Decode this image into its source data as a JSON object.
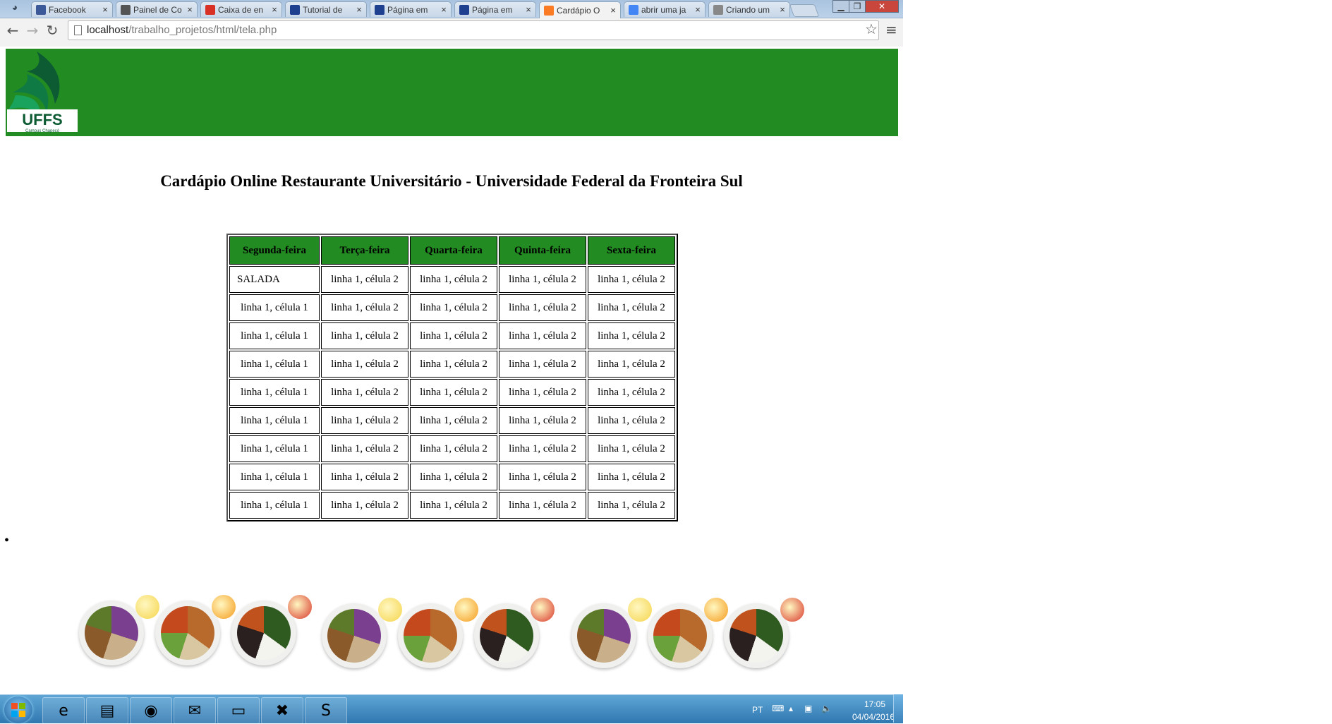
{
  "browser": {
    "tabs": [
      {
        "title": "Facebook",
        "icon": "facebook-icon",
        "color": "#3b5998"
      },
      {
        "title": "Painel de Co",
        "icon": "asterisk-icon",
        "color": "#555555"
      },
      {
        "title": "Caixa de en",
        "icon": "gmail-icon",
        "color": "#d93025"
      },
      {
        "title": "Tutorial de",
        "icon": "hr-icon",
        "color": "#1f3f8f"
      },
      {
        "title": "Página em",
        "icon": "hr-icon",
        "color": "#1f3f8f"
      },
      {
        "title": "Página em",
        "icon": "hr-icon",
        "color": "#1f3f8f"
      },
      {
        "title": "Cardápio O",
        "icon": "xampp-icon",
        "color": "#fb7a24",
        "active": true
      },
      {
        "title": "abrir uma ja",
        "icon": "google-icon",
        "color": "#4285f4"
      },
      {
        "title": "Criando um",
        "icon": "page-icon",
        "color": "#888888"
      }
    ],
    "url_host": "localhost",
    "url_path": "/trabalho_projetos/html/tela.php"
  },
  "page": {
    "logo_text": "UFFS",
    "logo_subtext": "Campus Chapecó",
    "title": "Cardápio Online Restaurante Universitário - Universidade Federal da Fronteira Sul",
    "banner_color": "#228b22",
    "table": {
      "headers": [
        "Segunda-feira",
        "Terça-feira",
        "Quarta-feira",
        "Quinta-feira",
        "Sexta-feira"
      ],
      "rows": [
        [
          "SALADA",
          "linha 1, célula 2",
          "linha 1, célula 2",
          "linha 1, célula 2",
          "linha 1, célula 2"
        ],
        [
          "linha 1, célula 1",
          "linha 1, célula 2",
          "linha 1, célula 2",
          "linha 1, célula 2",
          "linha 1, célula 2"
        ],
        [
          "linha 1, célula 1",
          "linha 1, célula 2",
          "linha 1, célula 2",
          "linha 1, célula 2",
          "linha 1, célula 2"
        ],
        [
          "linha 1, célula 1",
          "linha 1, célula 2",
          "linha 1, célula 2",
          "linha 1, célula 2",
          "linha 1, célula 2"
        ],
        [
          "linha 1, célula 1",
          "linha 1, célula 2",
          "linha 1, célula 2",
          "linha 1, célula 2",
          "linha 1, célula 2"
        ],
        [
          "linha 1, célula 1",
          "linha 1, célula 2",
          "linha 1, célula 2",
          "linha 1, célula 2",
          "linha 1, célula 2"
        ],
        [
          "linha 1, célula 1",
          "linha 1, célula 2",
          "linha 1, célula 2",
          "linha 1, célula 2",
          "linha 1, célula 2"
        ],
        [
          "linha 1, célula 1",
          "linha 1, célula 2",
          "linha 1, célula 2",
          "linha 1, célula 2",
          "linha 1, célula 2"
        ],
        [
          "linha 1, célula 1",
          "linha 1, célula 2",
          "linha 1, célula 2",
          "linha 1, célula 2",
          "linha 1, célula 2"
        ]
      ]
    },
    "bullet": "•"
  },
  "taskbar": {
    "apps": [
      {
        "name": "internet-explorer-icon",
        "glyph": "e"
      },
      {
        "name": "file-explorer-icon",
        "glyph": "▤"
      },
      {
        "name": "chrome-icon",
        "glyph": "◉"
      },
      {
        "name": "thunderbird-icon",
        "glyph": "✉"
      },
      {
        "name": "folder-icon",
        "glyph": "▭"
      },
      {
        "name": "xampp-icon",
        "glyph": "✖"
      },
      {
        "name": "sublime-text-icon",
        "glyph": "S"
      }
    ],
    "language": "PT",
    "time": "17:05",
    "date": "04/04/2016"
  }
}
